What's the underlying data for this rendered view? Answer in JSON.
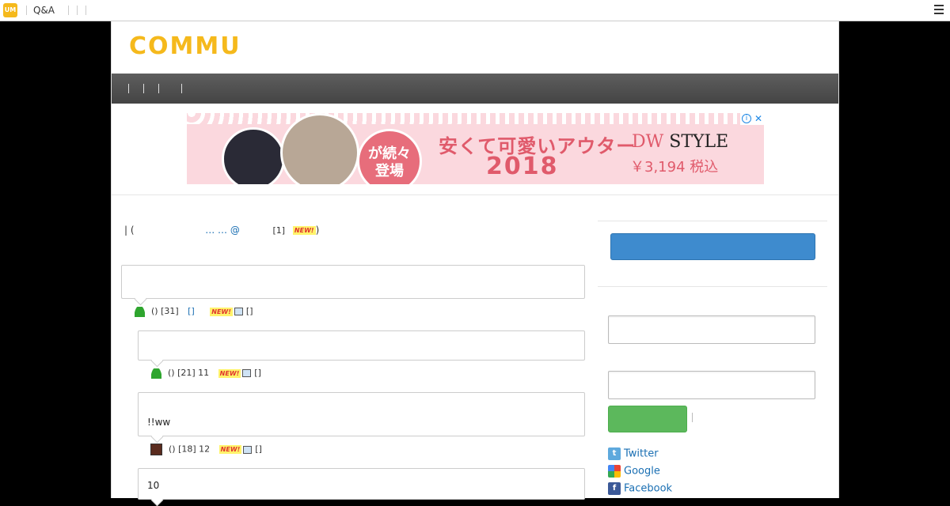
{
  "topbar": {
    "qa_label": "Q&A"
  },
  "brand": {
    "name": "COMMU",
    "color": "#f5b91c"
  },
  "ad": {
    "badge_text": "が続々\n登場",
    "headline": "安くて可愛いアウター",
    "year": "2018",
    "brand_prefix": "DW",
    "brand_suffix": " STYLE",
    "price": "￥3,194 税込"
  },
  "breadcrumb": {
    "prefix": "| (",
    "link": "… … @",
    "count": "[1]",
    "new": "NEW!",
    "suffix": ")"
  },
  "posts": [
    {
      "text": "",
      "meta": "() [31]",
      "link": "[]",
      "new": "NEW!",
      "tail": "[]"
    },
    {
      "text": "",
      "meta": "() [21] 11",
      "new": "NEW!",
      "tail": "[]"
    },
    {
      "text": "!!ww",
      "meta": "() [18] 12",
      "new": "NEW!",
      "tail": "[]"
    },
    {
      "text": "10"
    }
  ],
  "social": {
    "twitter": "Twitter",
    "google": "Google",
    "facebook": "Facebook"
  }
}
